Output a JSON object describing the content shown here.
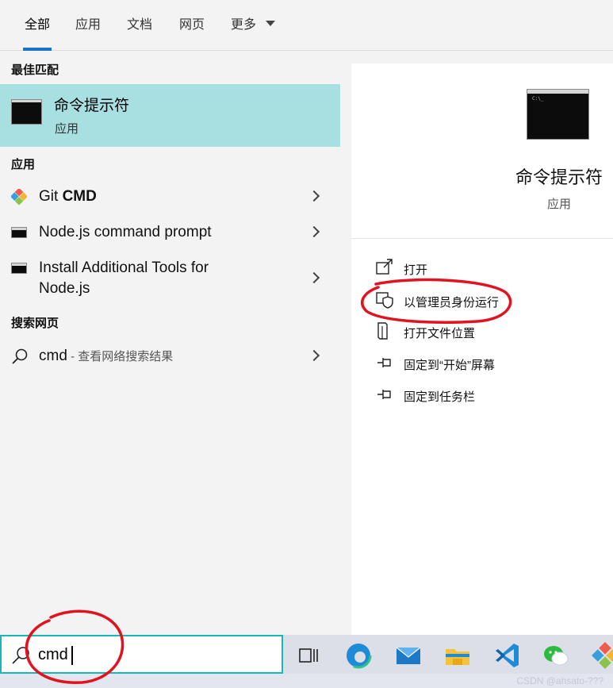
{
  "tabs": [
    {
      "label": "全部",
      "active": true
    },
    {
      "label": "应用"
    },
    {
      "label": "文档"
    },
    {
      "label": "网页"
    },
    {
      "label": "更多"
    }
  ],
  "left": {
    "best_match_title": "最佳匹配",
    "best_match": {
      "name": "命令提示符",
      "type": "应用",
      "icon": "cmd-icon"
    },
    "apps_title": "应用",
    "apps": [
      {
        "name_plain": "Git ",
        "name_bold": "CMD",
        "icon": "git-icon"
      },
      {
        "name": "Node.js command prompt",
        "icon": "cmd-icon"
      },
      {
        "name_line1": "Install Additional Tools for",
        "name_line2": "Node.js",
        "icon": "cmd-icon"
      }
    ],
    "web_title": "搜索网页",
    "web": {
      "query": "cmd",
      "suffix": " - 查看网络搜索结果",
      "icon": "search-icon"
    }
  },
  "right": {
    "title": "命令提示符",
    "subtitle": "应用",
    "actions": [
      {
        "label": "打开",
        "icon": "open-icon"
      },
      {
        "label": "以管理员身份运行",
        "icon": "shield-icon"
      },
      {
        "label": "打开文件位置",
        "icon": "folder-location-icon"
      },
      {
        "label": "固定到“开始”屏幕",
        "icon": "pin-icon"
      },
      {
        "label": "固定到任务栏",
        "icon": "pin-icon"
      }
    ]
  },
  "search": {
    "value": "cmd"
  },
  "taskbar": [
    "task-view-icon",
    "edge-icon",
    "mail-icon",
    "file-explorer-icon",
    "vscode-icon",
    "wechat-icon",
    "git-icon"
  ],
  "colors": {
    "accent": "#1a73c4",
    "best_match_bg": "#a8dfe1",
    "search_border": "#19b6bd",
    "annotation": "#e0141e"
  },
  "watermark": "CSDN @ahsato-???"
}
